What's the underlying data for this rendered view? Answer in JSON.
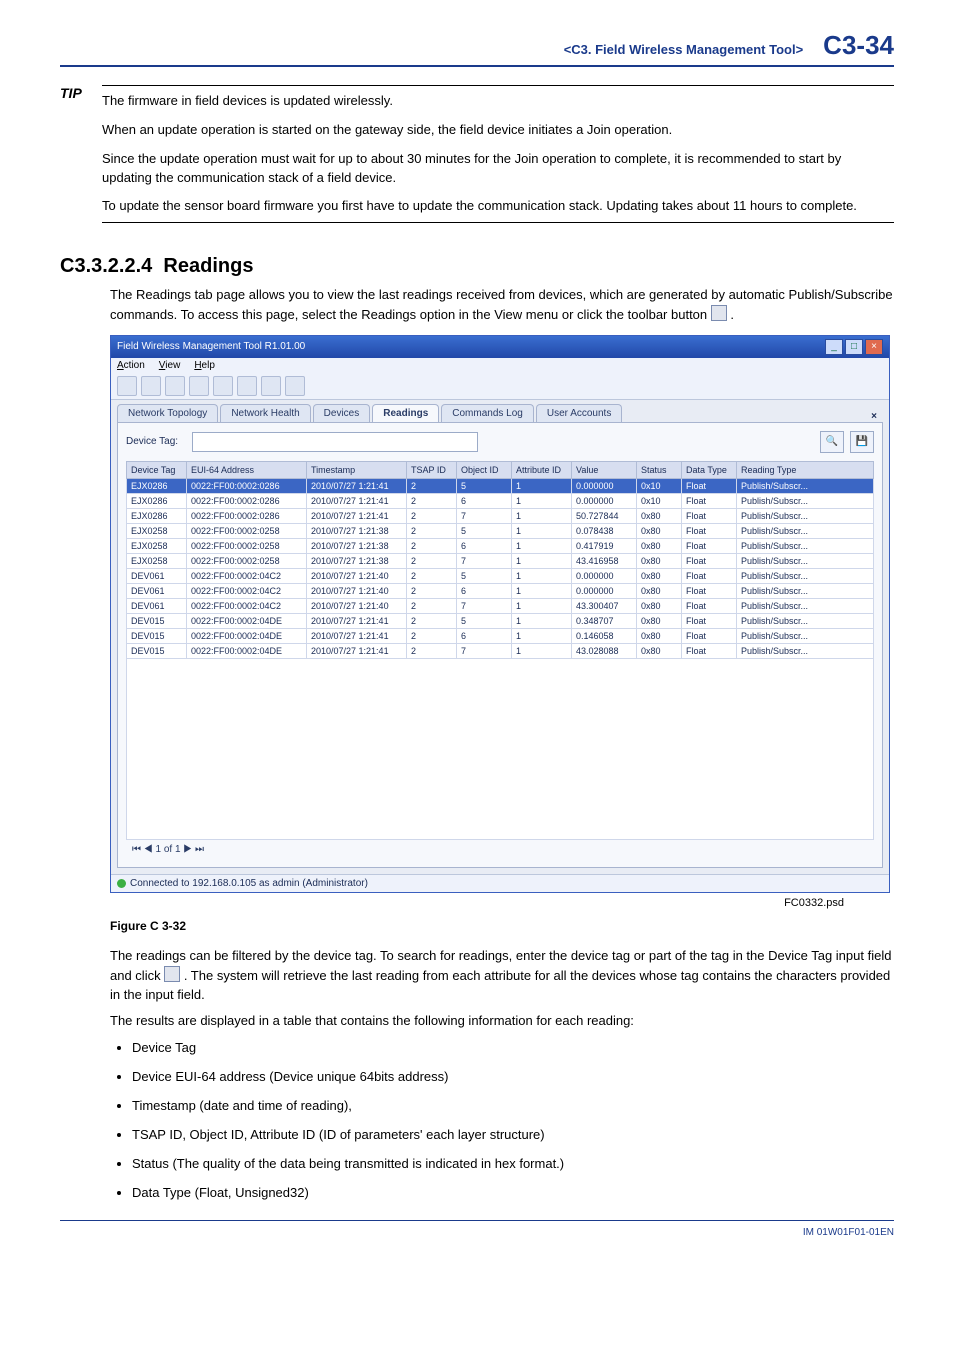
{
  "header": {
    "title": "<C3.  Field Wireless Management Tool>",
    "page": "C3-34"
  },
  "tip": {
    "label": "TIP",
    "paras": [
      "The firmware in field devices is updated wirelessly.",
      "When an update operation is started on the gateway side, the field device initiates a Join operation.",
      "Since the update operation must wait for up to about 30 minutes for the Join operation to complete, it is recommended to start by updating the communication stack of a field device.",
      "To update the sensor board firmware you first have to update the communication stack.  Updating takes about 11 hours to complete."
    ]
  },
  "section": {
    "number": "C3.3.2.2.4",
    "title": "Readings",
    "intro": "The Readings tab page allows you to view the last readings received from devices, which are generated by automatic Publish/Subscribe commands. To access this page, select the Readings option in the View menu or click the toolbar button ",
    "intro_tail": " ."
  },
  "win": {
    "title": "Field Wireless Management Tool R1.01.00",
    "menus": [
      "Action",
      "View",
      "Help"
    ],
    "tabs": [
      "Network Topology",
      "Network Health",
      "Devices",
      "Readings",
      "Commands Log",
      "User Accounts"
    ],
    "active_tab": "Readings",
    "search_label": "Device Tag:",
    "cols": [
      "Device Tag",
      "EUI-64 Address",
      "Timestamp",
      "TSAP ID",
      "Object ID",
      "Attribute ID",
      "Value",
      "Status",
      "Data Type",
      "Reading Type"
    ],
    "rows": [
      [
        "EJX0286",
        "0022:FF00:0002:0286",
        "2010/07/27 1:21:41",
        "2",
        "5",
        "1",
        "0.000000",
        "0x10",
        "Float",
        "Publish/Subscr..."
      ],
      [
        "EJX0286",
        "0022:FF00:0002:0286",
        "2010/07/27 1:21:41",
        "2",
        "6",
        "1",
        "0.000000",
        "0x10",
        "Float",
        "Publish/Subscr..."
      ],
      [
        "EJX0286",
        "0022:FF00:0002:0286",
        "2010/07/27 1:21:41",
        "2",
        "7",
        "1",
        "50.727844",
        "0x80",
        "Float",
        "Publish/Subscr..."
      ],
      [
        "EJX0258",
        "0022:FF00:0002:0258",
        "2010/07/27 1:21:38",
        "2",
        "5",
        "1",
        "0.078438",
        "0x80",
        "Float",
        "Publish/Subscr..."
      ],
      [
        "EJX0258",
        "0022:FF00:0002:0258",
        "2010/07/27 1:21:38",
        "2",
        "6",
        "1",
        "0.417919",
        "0x80",
        "Float",
        "Publish/Subscr..."
      ],
      [
        "EJX0258",
        "0022:FF00:0002:0258",
        "2010/07/27 1:21:38",
        "2",
        "7",
        "1",
        "43.416958",
        "0x80",
        "Float",
        "Publish/Subscr..."
      ],
      [
        "DEV061",
        "0022:FF00:0002:04C2",
        "2010/07/27 1:21:40",
        "2",
        "5",
        "1",
        "0.000000",
        "0x80",
        "Float",
        "Publish/Subscr..."
      ],
      [
        "DEV061",
        "0022:FF00:0002:04C2",
        "2010/07/27 1:21:40",
        "2",
        "6",
        "1",
        "0.000000",
        "0x80",
        "Float",
        "Publish/Subscr..."
      ],
      [
        "DEV061",
        "0022:FF00:0002:04C2",
        "2010/07/27 1:21:40",
        "2",
        "7",
        "1",
        "43.300407",
        "0x80",
        "Float",
        "Publish/Subscr..."
      ],
      [
        "DEV015",
        "0022:FF00:0002:04DE",
        "2010/07/27 1:21:41",
        "2",
        "5",
        "1",
        "0.348707",
        "0x80",
        "Float",
        "Publish/Subscr..."
      ],
      [
        "DEV015",
        "0022:FF00:0002:04DE",
        "2010/07/27 1:21:41",
        "2",
        "6",
        "1",
        "0.146058",
        "0x80",
        "Float",
        "Publish/Subscr..."
      ],
      [
        "DEV015",
        "0022:FF00:0002:04DE",
        "2010/07/27 1:21:41",
        "2",
        "7",
        "1",
        "43.028088",
        "0x80",
        "Float",
        "Publish/Subscr..."
      ]
    ],
    "pager": "1 of 1",
    "status": "Connected to 192.168.0.105 as admin (Administrator)"
  },
  "fig_label": "FC0332.psd",
  "fig_caption": "Figure C 3-32",
  "after": {
    "p1a": "The readings can be filtered by the device tag. To search for readings, enter the device tag or part of the tag in the Device Tag input field and click ",
    "p1b": " . The system will retrieve the last reading from each attribute for all the devices whose tag contains the characters provided in the input field.",
    "p2": "The results are displayed in a table that contains the following information for each reading:"
  },
  "bullets": [
    "Device Tag",
    "Device EUI-64 address (Device unique 64bits address)",
    "Timestamp (date and time of reading),",
    "TSAP ID, Object ID, Attribute ID (ID of parameters' each layer structure)",
    "Status (The quality of the data being transmitted is indicated in hex format.)",
    "Data Type (Float, Unsigned32)"
  ],
  "footer": "IM 01W01F01-01EN"
}
